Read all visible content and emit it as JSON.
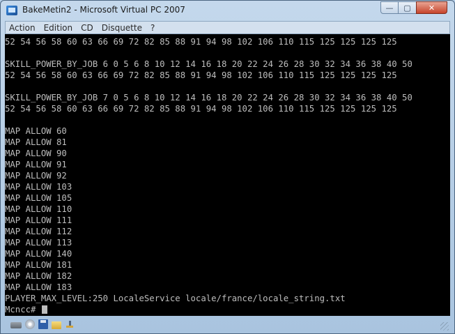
{
  "window": {
    "title": "BakeMetin2 - Microsoft Virtual PC 2007",
    "controls": {
      "minimize": "—",
      "maximize": "▢",
      "close": "✕"
    }
  },
  "menu": [
    "Action",
    "Edition",
    "CD",
    "Disquette",
    "?"
  ],
  "console": {
    "lines": [
      "52 54 56 58 60 63 66 69 72 82 85 88 91 94 98 102 106 110 115 125 125 125 125",
      "",
      "SKILL_POWER_BY_JOB 6 0 5 6 8 10 12 14 16 18 20 22 24 26 28 30 32 34 36 38 40 50",
      "52 54 56 58 60 63 66 69 72 82 85 88 91 94 98 102 106 110 115 125 125 125 125",
      "",
      "SKILL_POWER_BY_JOB 7 0 5 6 8 10 12 14 16 18 20 22 24 26 28 30 32 34 36 38 40 50",
      "52 54 56 58 60 63 66 69 72 82 85 88 91 94 98 102 106 110 115 125 125 125 125",
      "",
      "MAP ALLOW 60",
      "MAP ALLOW 81",
      "MAP ALLOW 90",
      "MAP ALLOW 91",
      "MAP ALLOW 92",
      "MAP ALLOW 103",
      "MAP ALLOW 105",
      "MAP ALLOW 110",
      "MAP ALLOW 111",
      "MAP ALLOW 112",
      "MAP ALLOW 113",
      "MAP ALLOW 140",
      "MAP ALLOW 181",
      "MAP ALLOW 182",
      "MAP ALLOW 183",
      "PLAYER_MAX_LEVEL:250 LocaleService locale/france/locale_string.txt"
    ],
    "prompt": "Mcncc# "
  },
  "statusbar": {
    "icons": [
      "hard-disk-icon",
      "cd-drive-icon",
      "floppy-icon",
      "shared-folder-icon",
      "network-icon"
    ]
  }
}
